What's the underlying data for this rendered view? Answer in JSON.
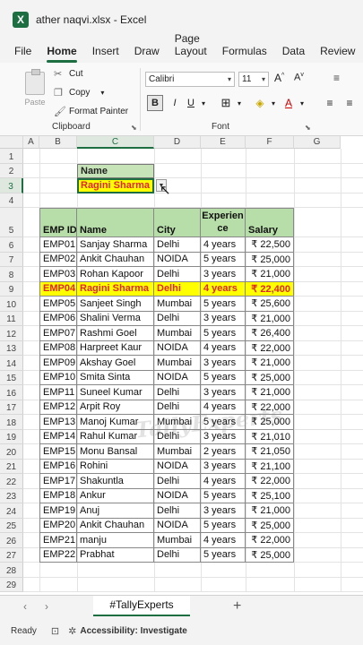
{
  "titlebar": {
    "logo": "X",
    "title": "ather naqvi.xlsx  -  Excel"
  },
  "menu": [
    "File",
    "Home",
    "Insert",
    "Draw",
    "Page Layout",
    "Formulas",
    "Data",
    "Review"
  ],
  "ribbon": {
    "paste": "Paste",
    "cut": "Cut",
    "copy": "Copy",
    "format_painter": "Format Painter",
    "clipboard_label": "Clipboard",
    "font_name": "Calibri",
    "font_size": "11",
    "font_label": "Font",
    "bold": "B",
    "underline": "U"
  },
  "columns": [
    "A",
    "B",
    "C",
    "D",
    "E",
    "F",
    "G"
  ],
  "rows": [
    "1",
    "2",
    "3",
    "4",
    "5",
    "6",
    "7",
    "8",
    "9",
    "10",
    "11",
    "12",
    "13",
    "14",
    "15",
    "16",
    "17",
    "18",
    "19",
    "20",
    "21",
    "22",
    "23",
    "24",
    "25",
    "26",
    "27",
    "28",
    "29"
  ],
  "lookup": {
    "label": "Name",
    "value": "Ragini Sharma"
  },
  "table": {
    "headers": [
      "EMP ID",
      "Name",
      "City",
      "Experien ce",
      "Salary"
    ],
    "rows": [
      [
        "EMP01",
        "Sanjay Sharma",
        "Delhi",
        "4 years",
        "₹ 22,500"
      ],
      [
        "EMP02",
        "Ankit Chauhan",
        "NOIDA",
        "5 years",
        "₹ 25,000"
      ],
      [
        "EMP03",
        "Rohan Kapoor",
        "Delhi",
        "3 years",
        "₹ 21,000"
      ],
      [
        "EMP04",
        "Ragini Sharma",
        "Delhi",
        "4 years",
        "₹ 22,400"
      ],
      [
        "EMP05",
        "Sanjeet Singh",
        "Mumbai",
        "5 years",
        "₹ 25,600"
      ],
      [
        "EMP06",
        "Shalini Verma",
        "Delhi",
        "3 years",
        "₹ 21,000"
      ],
      [
        "EMP07",
        "Rashmi Goel",
        "Mumbai",
        "5 years",
        "₹ 26,400"
      ],
      [
        "EMP08",
        "Harpreet Kaur",
        "NOIDA",
        "4 years",
        "₹ 22,000"
      ],
      [
        "EMP09",
        "Akshay Goel",
        "Mumbai",
        "3 years",
        "₹ 21,000"
      ],
      [
        "EMP10",
        "Smita Sinta",
        "NOIDA",
        "5 years",
        "₹ 25,000"
      ],
      [
        "EMP11",
        "Suneel Kumar",
        "Delhi",
        "3 years",
        "₹ 21,000"
      ],
      [
        "EMP12",
        "Arpit Roy",
        "Delhi",
        "4 years",
        "₹ 22,000"
      ],
      [
        "EMP13",
        "Manoj Kumar",
        "Mumbai",
        "5 years",
        "₹ 25,000"
      ],
      [
        "EMP14",
        "Rahul Kumar",
        "Delhi",
        "3 years",
        "₹ 21,010"
      ],
      [
        "EMP15",
        "Monu Bansal",
        "Mumbai",
        "2 years",
        "₹ 21,050"
      ],
      [
        "EMP16",
        "Rohini",
        "NOIDA",
        "3 years",
        "₹ 21,100"
      ],
      [
        "EMP17",
        "Shakuntla",
        "Delhi",
        "4 years",
        "₹ 22,000"
      ],
      [
        "EMP18",
        "Ankur",
        "NOIDA",
        "5 years",
        "₹ 25,100"
      ],
      [
        "EMP19",
        "Anuj",
        "Delhi",
        "3 years",
        "₹ 21,000"
      ],
      [
        "EMP20",
        "Ankit Chauhan",
        "NOIDA",
        "5 years",
        "₹ 25,000"
      ],
      [
        "EMP21",
        "manju",
        "Mumbai",
        "4 years",
        "₹ 22,000"
      ],
      [
        "EMP22",
        "Prabhat",
        "Delhi",
        "5 years",
        "₹ 25,000"
      ]
    ],
    "highlight_row": 3
  },
  "watermark": "TallyExperts",
  "sheet": {
    "tab": "#TallyExperts"
  },
  "status": {
    "ready": "Ready",
    "accessibility": "Accessibility: Investigate"
  },
  "colors": {
    "accent": "#1d6f42",
    "header_green": "#b7dea8",
    "highlight": "#ffff00",
    "highlight_text": "#e0262c"
  }
}
